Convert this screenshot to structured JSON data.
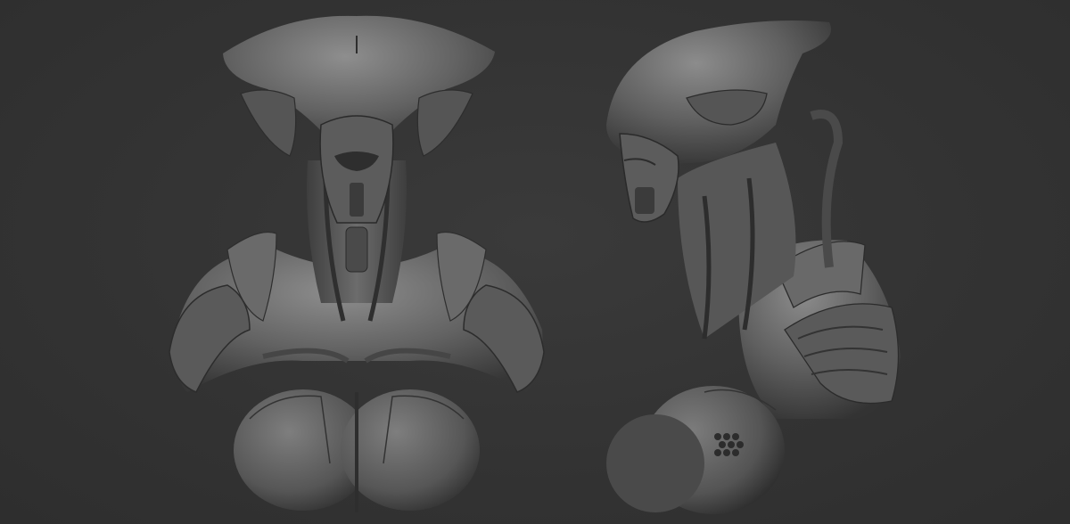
{
  "scene": {
    "background_color": "#333333",
    "subject": "grey-clay-bust",
    "views": [
      {
        "name": "front-view"
      },
      {
        "name": "side-view"
      }
    ],
    "colors": {
      "clay_light": "#8a8a8a",
      "clay_mid": "#5e5e5e",
      "clay_dark": "#3c3c3c",
      "clay_shadow": "#262626"
    }
  }
}
